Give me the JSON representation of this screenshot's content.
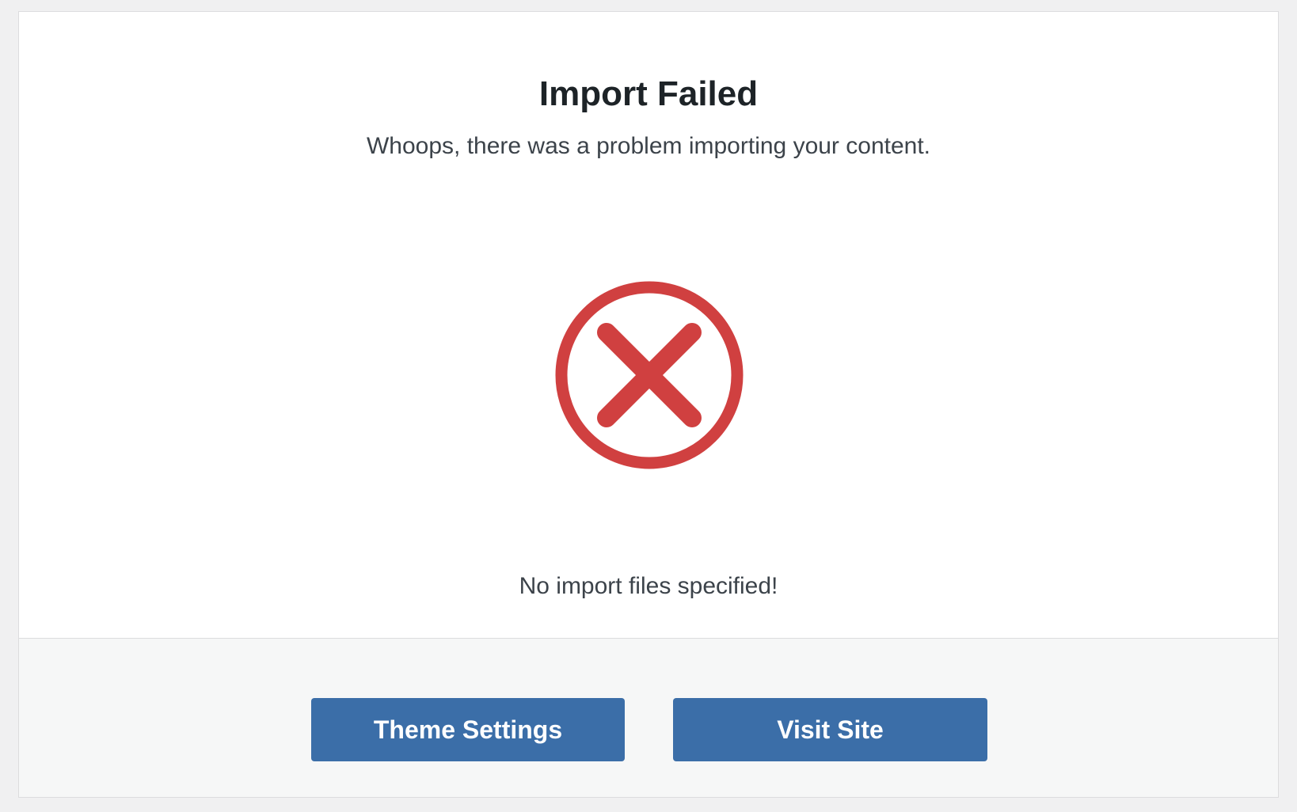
{
  "dialog": {
    "title": "Import Failed",
    "subtitle": "Whoops, there was a problem importing your content.",
    "status_icon": "error-circle-x-icon",
    "message": "No import files specified!"
  },
  "footer": {
    "theme_settings_label": "Theme Settings",
    "visit_site_label": "Visit Site"
  },
  "colors": {
    "error": "#d04040",
    "button": "#3b6ea8",
    "button_text": "#ffffff",
    "page_background": "#f0f0f1",
    "footer_background": "#f6f7f7"
  }
}
